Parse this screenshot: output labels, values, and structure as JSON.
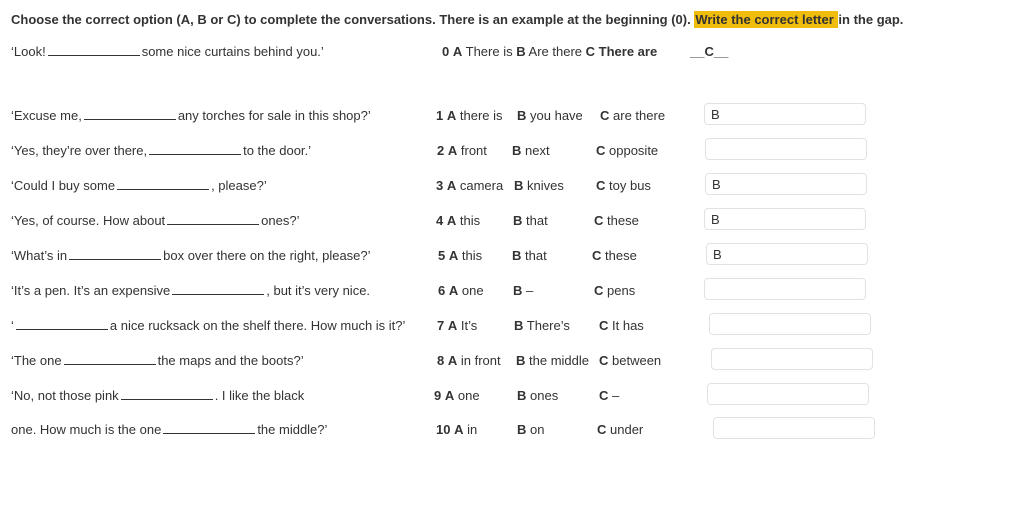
{
  "instructions": {
    "part1": "Choose the correct option (A, B or C) to complete the conversations. There is an example at the beginning (0). ",
    "highlight": "Write the correct letter ",
    "part2": "in the gap."
  },
  "example": {
    "before": "‘Look!",
    "after": "some nice curtains behind you.’",
    "num": "0",
    "a": "There is",
    "b": "Are there",
    "c": "There are",
    "answer": "__C__"
  },
  "questions": [
    {
      "before": "‘Excuse me,",
      "after": "any torches for sale in this shop?’",
      "num": "1",
      "a": "there is",
      "b": "you have",
      "c": "are there",
      "answer": "B"
    },
    {
      "before": "‘Yes, they’re over there,",
      "after": "to the door.’",
      "num": "2",
      "a": "front",
      "b": "next",
      "c": "opposite",
      "answer": ""
    },
    {
      "before": "‘Could I buy some",
      "after": ", please?’",
      "num": "3",
      "a": "camera",
      "b": "knives",
      "c": "toy bus",
      "answer": "B"
    },
    {
      "before": "‘Yes, of course. How about",
      "after": "ones?’",
      "num": "4",
      "a": "this",
      "b": "that",
      "c": "these",
      "answer": "B"
    },
    {
      "before": "‘What’s in",
      "after": "box over there on the right, please?’",
      "num": "5",
      "a": "this",
      "b": "that",
      "c": "these",
      "answer": "B"
    },
    {
      "before": "‘It’s a pen. It’s an expensive",
      "after": ", but it’s very nice.",
      "num": "6",
      "a": "one",
      "b": "–",
      "c": "pens",
      "answer": ""
    },
    {
      "before": "‘",
      "after": "a nice rucksack on the shelf there. How much is it?’",
      "num": "7",
      "a": "It’s",
      "b": "There’s",
      "c": "It has",
      "answer": ""
    },
    {
      "before": "‘The one",
      "after": "the maps and the boots?’",
      "num": "8",
      "a": "in front",
      "b": "the middle",
      "c": "between",
      "answer": ""
    },
    {
      "before": "‘No, not those pink",
      "after": ". I like the black",
      "num": "9",
      "a": "one",
      "b": "ones",
      "c": "–",
      "answer": ""
    },
    {
      "before": "one. How much is the one",
      "after": "the middle?’",
      "num": "10",
      "a": "in",
      "b": "on",
      "c": "under",
      "answer": ""
    }
  ],
  "labels": {
    "a": "A",
    "b": "B",
    "c": "C"
  }
}
